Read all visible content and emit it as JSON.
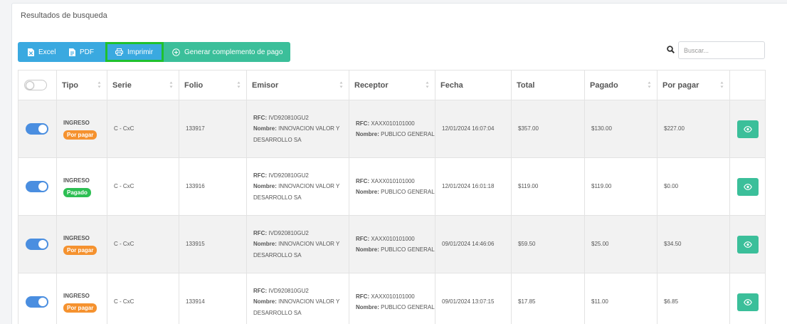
{
  "panel": {
    "title": "Resultados de busqueda"
  },
  "toolbar": {
    "excel_label": "Excel",
    "pdf_label": "PDF",
    "print_label": "Imprimir",
    "generate_label": "Generar complemento de pago"
  },
  "search": {
    "placeholder": "Buscar..."
  },
  "table": {
    "headers": {
      "tipo": "Tipo",
      "serie": "Serie",
      "folio": "Folio",
      "emisor": "Emisor",
      "receptor": "Receptor",
      "fecha": "Fecha",
      "total": "Total",
      "pagado": "Pagado",
      "por_pagar": "Por pagar"
    },
    "rfc_prefix": "RFC:",
    "nombre_prefix": "Nombre:",
    "rows": [
      {
        "selected": true,
        "tipo": "INGRESO",
        "status": "Por pagar",
        "serie": "C - CxC",
        "folio": "133917",
        "emisor_rfc": "IVD920810GU2",
        "emisor_nombre": "INNOVACION VALOR Y DESARROLLO SA",
        "receptor_rfc": "XAXX010101000",
        "receptor_nombre": "PUBLICO GENERAL",
        "fecha": "12/01/2024 16:07:04",
        "total": "$357.00",
        "pagado": "$130.00",
        "por_pagar": "$227.00"
      },
      {
        "selected": true,
        "tipo": "INGRESO",
        "status": "Pagado",
        "serie": "C - CxC",
        "folio": "133916",
        "emisor_rfc": "IVD920810GU2",
        "emisor_nombre": "INNOVACION VALOR Y DESARROLLO SA",
        "receptor_rfc": "XAXX010101000",
        "receptor_nombre": "PUBLICO GENERAL",
        "fecha": "12/01/2024 16:01:18",
        "total": "$119.00",
        "pagado": "$119.00",
        "por_pagar": "$0.00"
      },
      {
        "selected": true,
        "tipo": "INGRESO",
        "status": "Por pagar",
        "serie": "C - CxC",
        "folio": "133915",
        "emisor_rfc": "IVD920810GU2",
        "emisor_nombre": "INNOVACION VALOR Y DESARROLLO SA",
        "receptor_rfc": "XAXX010101000",
        "receptor_nombre": "PUBLICO GENERAL",
        "fecha": "09/01/2024 14:46:06",
        "total": "$59.50",
        "pagado": "$25.00",
        "por_pagar": "$34.50"
      },
      {
        "selected": true,
        "tipo": "INGRESO",
        "status": "Por pagar",
        "serie": "C - CxC",
        "folio": "133914",
        "emisor_rfc": "IVD920810GU2",
        "emisor_nombre": "INNOVACION VALOR Y DESARROLLO SA",
        "receptor_rfc": "XAXX010101000",
        "receptor_nombre": "PUBLICO GENERAL",
        "fecha": "09/01/2024 13:07:15",
        "total": "$17.85",
        "pagado": "$11.00",
        "por_pagar": "$6.85"
      }
    ]
  },
  "colors": {
    "toolbar_blue": "#3aa9e0",
    "toolbar_green": "#3bbf9a",
    "highlight_border": "#1fc12d",
    "toggle_on": "#4a8ee0",
    "badge_por_pagar": "#f5922f",
    "badge_pagado": "#2dbf53"
  },
  "icons": {
    "excel": "excel-file-icon",
    "pdf": "pdf-file-icon",
    "print": "printer-icon",
    "generate": "plus-circle-icon",
    "search": "search-icon",
    "view": "eye-icon",
    "sort": "sort-icon"
  }
}
